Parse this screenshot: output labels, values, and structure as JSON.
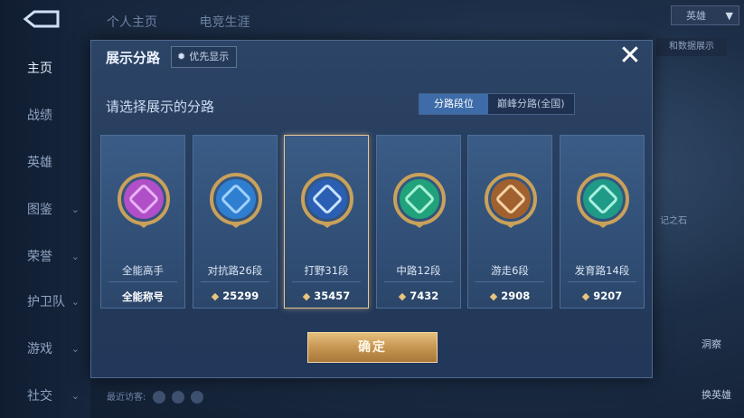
{
  "top_tabs": [
    "个人主页",
    "电竞生涯"
  ],
  "top_right_select": "英雄",
  "nav": [
    {
      "label": "主页",
      "active": true,
      "chevron": false
    },
    {
      "label": "战绩",
      "active": false,
      "chevron": false
    },
    {
      "label": "英雄",
      "active": false,
      "chevron": false
    },
    {
      "label": "图鉴",
      "active": false,
      "chevron": true
    },
    {
      "label": "荣誉",
      "active": false,
      "chevron": true
    },
    {
      "label": "护卫队",
      "active": false,
      "chevron": true
    },
    {
      "label": "游戏",
      "active": false,
      "chevron": true
    },
    {
      "label": "社交",
      "active": false,
      "chevron": true
    }
  ],
  "background": {
    "chip_text": "和数据展示",
    "side_text": "记之石",
    "right_buttons": [
      "洞察",
      "换英雄"
    ],
    "visitors_label": "最近访客:"
  },
  "modal": {
    "title": "展示分路",
    "priority_label": "优先显示",
    "subtitle": "请选择展示的分路",
    "segments": [
      {
        "label": "分路段位",
        "active": true
      },
      {
        "label": "巅峰分路(全国)",
        "active": false
      }
    ],
    "cards": [
      {
        "name": "全能高手",
        "score": "全能称号",
        "show_gem": false,
        "selected": false,
        "emblem_color": "#b04fc8",
        "emblem_inner": "#e9b2f5"
      },
      {
        "name": "对抗路26段",
        "score": "25299",
        "show_gem": true,
        "selected": false,
        "emblem_color": "#2f7fd0",
        "emblem_inner": "#9fd0ff"
      },
      {
        "name": "打野31段",
        "score": "35457",
        "show_gem": true,
        "selected": true,
        "emblem_color": "#2a5fb3",
        "emblem_inner": "#c9e2ff"
      },
      {
        "name": "中路12段",
        "score": "7432",
        "show_gem": true,
        "selected": false,
        "emblem_color": "#20a37a",
        "emblem_inner": "#a6f2d6"
      },
      {
        "name": "游走6段",
        "score": "2908",
        "show_gem": true,
        "selected": false,
        "emblem_color": "#a0612e",
        "emblem_inner": "#f5d2a6"
      },
      {
        "name": "发育路14段",
        "score": "9207",
        "show_gem": true,
        "selected": false,
        "emblem_color": "#1f9a86",
        "emblem_inner": "#a8f0e0"
      }
    ],
    "confirm_label": "确定",
    "colors": {
      "accent_gold": "#e6c693",
      "active_tab": "#3d6ca8"
    }
  }
}
